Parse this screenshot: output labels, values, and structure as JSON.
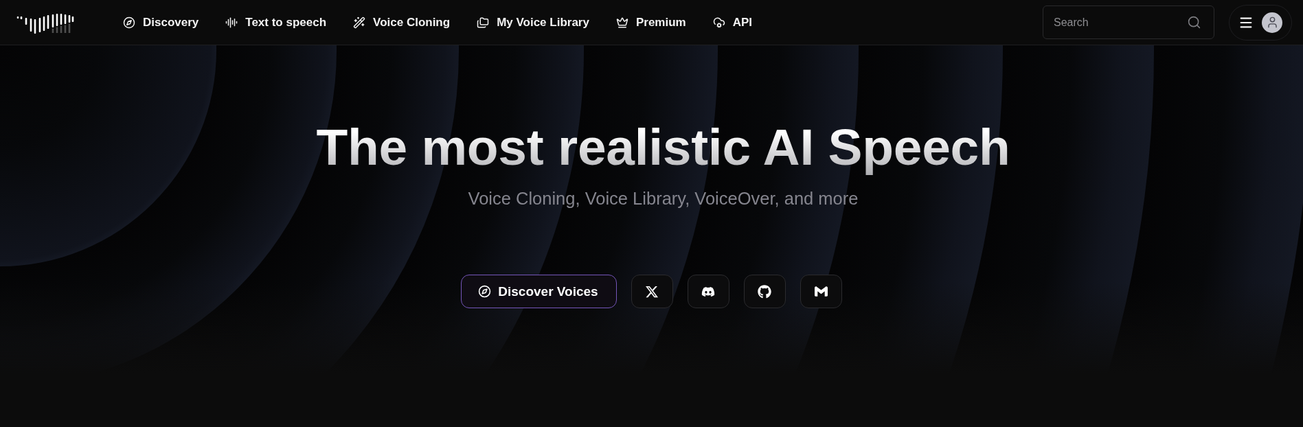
{
  "nav": {
    "items": [
      {
        "label": "Discovery"
      },
      {
        "label": "Text to speech"
      },
      {
        "label": "Voice Cloning"
      },
      {
        "label": "My Voice Library"
      },
      {
        "label": "Premium"
      },
      {
        "label": "API"
      }
    ]
  },
  "search": {
    "placeholder": "Search"
  },
  "hero": {
    "title": "The most realistic AI Speech",
    "subtitle": "Voice Cloning, Voice Library, VoiceOver, and more",
    "primary_button": {
      "label": "Discover Voices"
    },
    "social_links": [
      {
        "kind": "x"
      },
      {
        "kind": "discord"
      },
      {
        "kind": "github"
      },
      {
        "kind": "m"
      }
    ]
  }
}
